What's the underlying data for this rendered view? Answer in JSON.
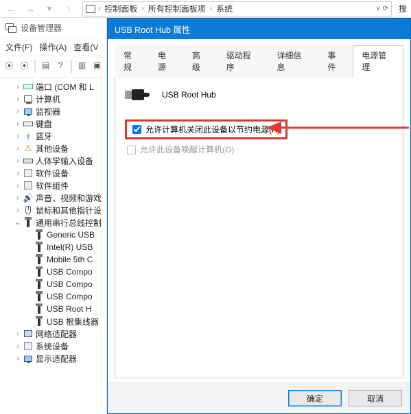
{
  "breadcrumb": {
    "segments": [
      "控制面板",
      "所有控制面板项",
      "系统"
    ],
    "search_hint": "搜"
  },
  "devmgr": {
    "title": "设备管理器",
    "menu": {
      "file": "文件(F)",
      "action": "操作(A)",
      "view": "查看(V"
    },
    "tree": [
      {
        "icon": "port",
        "label": "端口 (COM 和 L",
        "tw": "›",
        "ind": 1
      },
      {
        "icon": "pc",
        "label": "计算机",
        "tw": "›",
        "ind": 1
      },
      {
        "icon": "monitor",
        "label": "监视器",
        "tw": "›",
        "ind": 1
      },
      {
        "icon": "kb",
        "label": "键盘",
        "tw": "›",
        "ind": 1
      },
      {
        "icon": "bt",
        "label": "蓝牙",
        "tw": "›",
        "ind": 1
      },
      {
        "icon": "other",
        "label": "其他设备",
        "tw": "›",
        "ind": 1
      },
      {
        "icon": "hid",
        "label": "人体学输入设备",
        "tw": "›",
        "ind": 1
      },
      {
        "icon": "sw",
        "label": "软件设备",
        "tw": "›",
        "ind": 1
      },
      {
        "icon": "sw",
        "label": "软件组件",
        "tw": "›",
        "ind": 1
      },
      {
        "icon": "audio",
        "label": "声音、视频和游戏",
        "tw": "›",
        "ind": 1
      },
      {
        "icon": "mouse",
        "label": "鼠标和其他指针设",
        "tw": "›",
        "ind": 1
      },
      {
        "icon": "usb",
        "label": "通用串行总线控制",
        "tw": "⌄",
        "ind": 1
      },
      {
        "icon": "usb",
        "label": "Generic USB",
        "tw": "",
        "ind": 2
      },
      {
        "icon": "usb",
        "label": "Intel(R) USB",
        "tw": "",
        "ind": 2
      },
      {
        "icon": "usb",
        "label": "Mobile 5th C",
        "tw": "",
        "ind": 2
      },
      {
        "icon": "usb",
        "label": "USB Compo",
        "tw": "",
        "ind": 2
      },
      {
        "icon": "usb",
        "label": "USB Compo",
        "tw": "",
        "ind": 2
      },
      {
        "icon": "usb",
        "label": "USB Compo",
        "tw": "",
        "ind": 2
      },
      {
        "icon": "usb",
        "label": "USB Root H",
        "tw": "",
        "ind": 2
      },
      {
        "icon": "usb",
        "label": "USB 根集线器",
        "tw": "",
        "ind": 2
      },
      {
        "icon": "net",
        "label": "网络适配器",
        "tw": "›",
        "ind": 1
      },
      {
        "icon": "sys",
        "label": "系统设备",
        "tw": "›",
        "ind": 1
      },
      {
        "icon": "monitor",
        "label": "显示适配器",
        "tw": "›",
        "ind": 1
      }
    ]
  },
  "dialog": {
    "title": "USB Root Hub 属性",
    "device_name": "USB Root Hub",
    "tabs": {
      "general": "常规",
      "power": "电源",
      "advanced": "高级",
      "driver": "驱动程序",
      "details": "详细信息",
      "events": "事件",
      "power_mgmt": "电源管理"
    },
    "opt_allow_off": "允许计算机关闭此设备以节约电源(A)",
    "opt_allow_wake": "允许此设备唤醒计算机(O)",
    "btn_ok": "确定",
    "btn_cancel": "取消"
  }
}
